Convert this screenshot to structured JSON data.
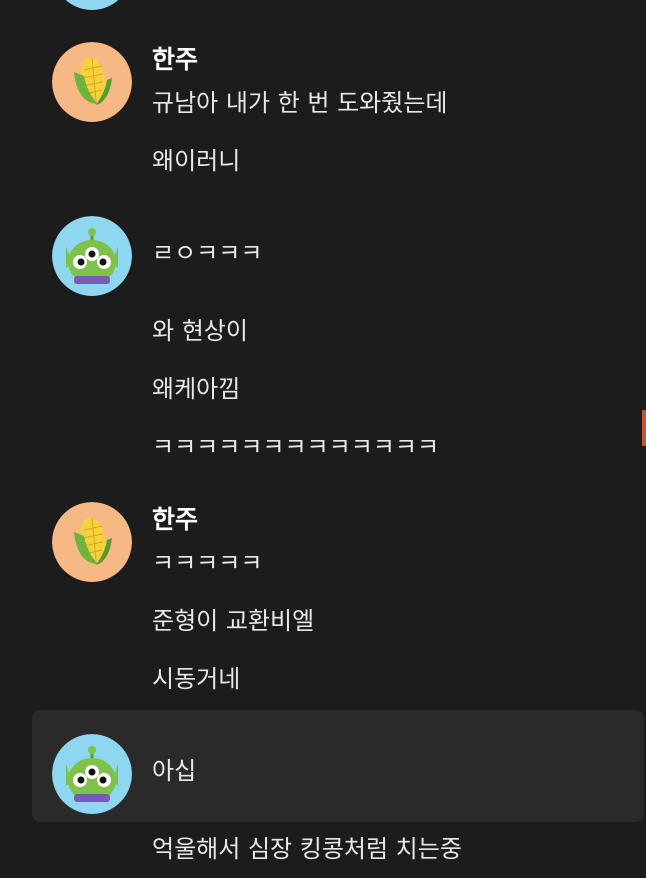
{
  "colors": {
    "background": "#1c1c1c",
    "highlight_row": "#2a2a2a",
    "corn_avatar_bg": "#f6b884",
    "alien_avatar_bg": "#8fd6f0",
    "scroll_marker": "#c8562a"
  },
  "messages": [
    {
      "sender": "한주",
      "avatar": "corn-icon",
      "lines": [
        "규남아 내가 한 번 도와줬는데",
        "왜이러니"
      ]
    },
    {
      "sender": "",
      "avatar": "alien-icon",
      "lines": [
        "ㄹㅇㅋㅋㅋ",
        "와 현상이",
        "왜케아낌",
        "ㅋㅋㅋㅋㅋㅋㅋㅋㅋㅋㅋㅋㅋ"
      ]
    },
    {
      "sender": "한주",
      "avatar": "corn-icon",
      "lines": [
        "ㅋㅋㅋㅋㅋ",
        "준형이 교환비엘",
        "시동거네"
      ]
    },
    {
      "sender": "",
      "avatar": "alien-icon",
      "lines": [
        "아십",
        "억울해서 심장 킹콩처럼 치는중"
      ]
    }
  ]
}
